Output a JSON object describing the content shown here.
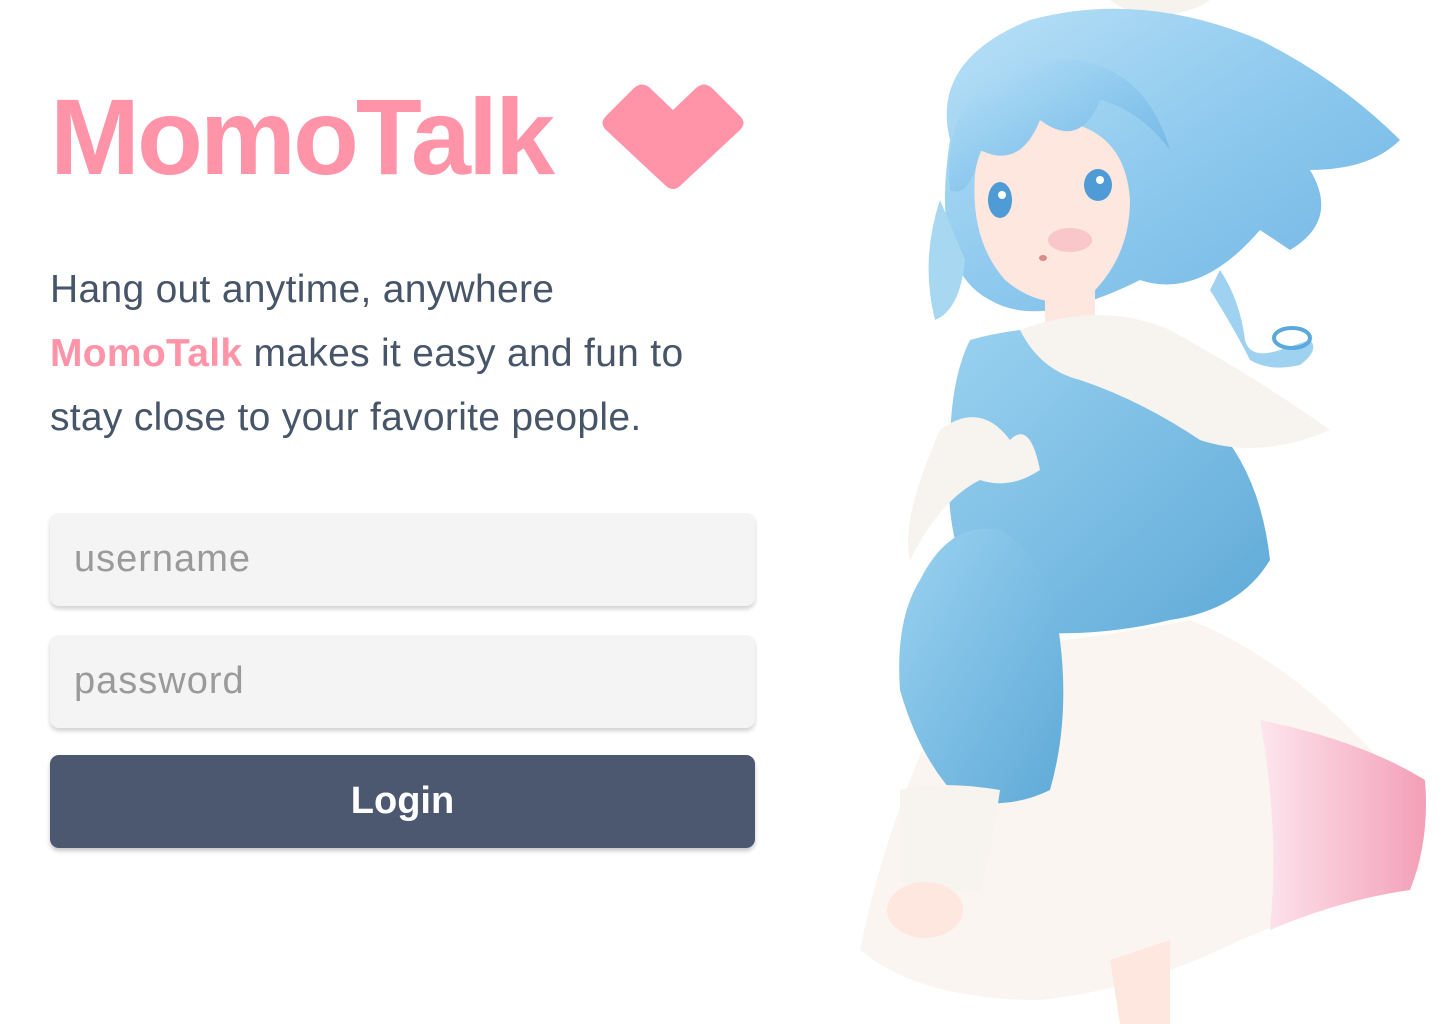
{
  "colors": {
    "accent": "#ff94a8",
    "text": "#475569",
    "button": "#4b5870",
    "hair": "#8ec9ee",
    "shirt": "#7fc0e6",
    "skirt": "#fbf5f1",
    "skirt_lining": "#f7b8c8",
    "skin": "#fde7df"
  },
  "brand": {
    "name": "MomoTalk",
    "icon": "heart-icon"
  },
  "tagline": {
    "line1": "Hang out anytime, anywhere",
    "highlight": "MomoTalk",
    "line2": "makes it easy and fun to",
    "line3": "stay close to your favorite people."
  },
  "form": {
    "username_placeholder": "username",
    "password_placeholder": "password",
    "login_label": "Login"
  },
  "illustration": {
    "subject": "illustration-anime-girl"
  }
}
